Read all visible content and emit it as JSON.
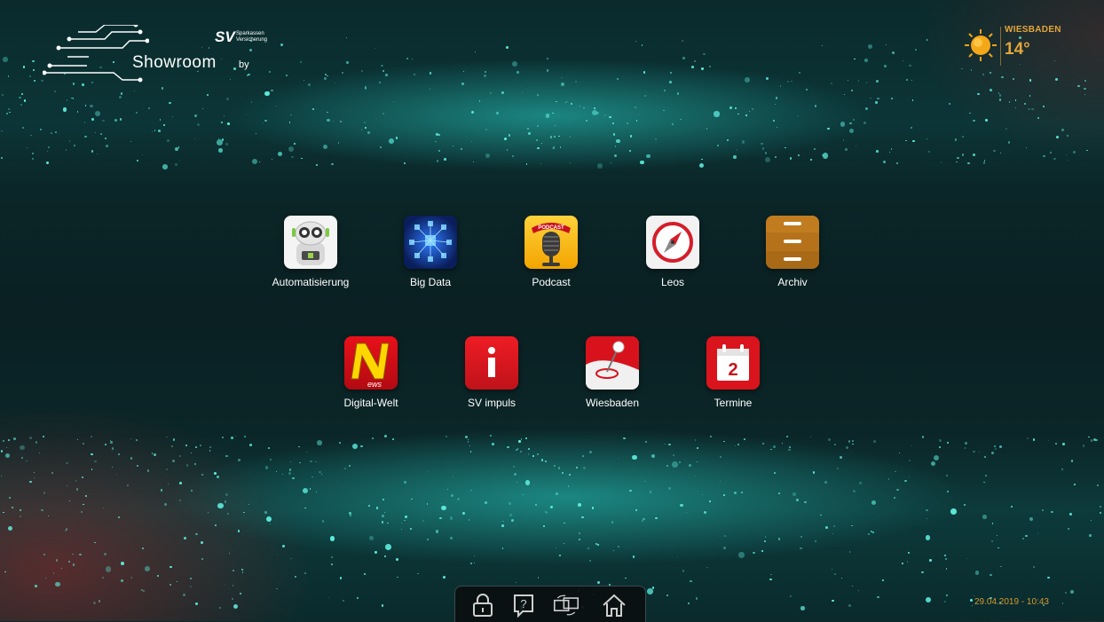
{
  "brand": {
    "wordmark": "Showroom",
    "by": "by",
    "partner_mark": "SV",
    "partner_line1": "Sparkassen",
    "partner_line2": "Versicherung"
  },
  "weather": {
    "city": "WIESBADEN",
    "temperature": "14°",
    "icon": "sun-icon"
  },
  "apps": [
    {
      "label": "Automatisierung",
      "icon": "robot-icon"
    },
    {
      "label": "Big Data",
      "icon": "big-data-cubes-icon"
    },
    {
      "label": "Podcast",
      "icon": "microphone-icon"
    },
    {
      "label": "Leos",
      "icon": "compass-icon"
    },
    {
      "label": "Archiv",
      "icon": "drawer-cabinet-icon"
    },
    {
      "label": "Digital-Welt",
      "icon": "news-n-icon"
    },
    {
      "label": "SV impuls",
      "icon": "info-icon"
    },
    {
      "label": "Wiesbaden",
      "icon": "map-pin-icon"
    },
    {
      "label": "Termine",
      "icon": "calendar-icon"
    }
  ],
  "calendar_day": "2",
  "news_badge": "ews",
  "podcast_badge": "PODCAST",
  "dock": [
    {
      "name": "lock-icon"
    },
    {
      "name": "help-icon"
    },
    {
      "name": "switch-screens-icon"
    },
    {
      "name": "home-icon"
    }
  ],
  "datetime": "29.04.2019 - 10:43",
  "colors": {
    "background": "#0a2a2c",
    "glitter": "#5ff0e0",
    "weather_accent": "#e3a63a"
  }
}
